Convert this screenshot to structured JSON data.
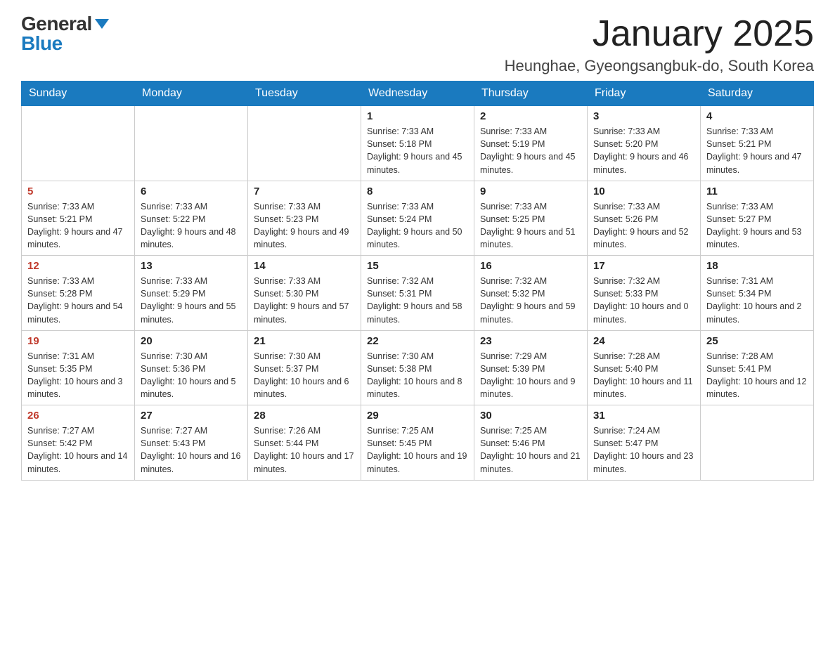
{
  "header": {
    "logo_general": "General",
    "logo_blue": "Blue",
    "title": "January 2025",
    "subtitle": "Heunghae, Gyeongsangbuk-do, South Korea"
  },
  "days_of_week": [
    "Sunday",
    "Monday",
    "Tuesday",
    "Wednesday",
    "Thursday",
    "Friday",
    "Saturday"
  ],
  "weeks": [
    [
      {
        "day": "",
        "info": ""
      },
      {
        "day": "",
        "info": ""
      },
      {
        "day": "",
        "info": ""
      },
      {
        "day": "1",
        "info": "Sunrise: 7:33 AM\nSunset: 5:18 PM\nDaylight: 9 hours and 45 minutes."
      },
      {
        "day": "2",
        "info": "Sunrise: 7:33 AM\nSunset: 5:19 PM\nDaylight: 9 hours and 45 minutes."
      },
      {
        "day": "3",
        "info": "Sunrise: 7:33 AM\nSunset: 5:20 PM\nDaylight: 9 hours and 46 minutes."
      },
      {
        "day": "4",
        "info": "Sunrise: 7:33 AM\nSunset: 5:21 PM\nDaylight: 9 hours and 47 minutes."
      }
    ],
    [
      {
        "day": "5",
        "info": "Sunrise: 7:33 AM\nSunset: 5:21 PM\nDaylight: 9 hours and 47 minutes."
      },
      {
        "day": "6",
        "info": "Sunrise: 7:33 AM\nSunset: 5:22 PM\nDaylight: 9 hours and 48 minutes."
      },
      {
        "day": "7",
        "info": "Sunrise: 7:33 AM\nSunset: 5:23 PM\nDaylight: 9 hours and 49 minutes."
      },
      {
        "day": "8",
        "info": "Sunrise: 7:33 AM\nSunset: 5:24 PM\nDaylight: 9 hours and 50 minutes."
      },
      {
        "day": "9",
        "info": "Sunrise: 7:33 AM\nSunset: 5:25 PM\nDaylight: 9 hours and 51 minutes."
      },
      {
        "day": "10",
        "info": "Sunrise: 7:33 AM\nSunset: 5:26 PM\nDaylight: 9 hours and 52 minutes."
      },
      {
        "day": "11",
        "info": "Sunrise: 7:33 AM\nSunset: 5:27 PM\nDaylight: 9 hours and 53 minutes."
      }
    ],
    [
      {
        "day": "12",
        "info": "Sunrise: 7:33 AM\nSunset: 5:28 PM\nDaylight: 9 hours and 54 minutes."
      },
      {
        "day": "13",
        "info": "Sunrise: 7:33 AM\nSunset: 5:29 PM\nDaylight: 9 hours and 55 minutes."
      },
      {
        "day": "14",
        "info": "Sunrise: 7:33 AM\nSunset: 5:30 PM\nDaylight: 9 hours and 57 minutes."
      },
      {
        "day": "15",
        "info": "Sunrise: 7:32 AM\nSunset: 5:31 PM\nDaylight: 9 hours and 58 minutes."
      },
      {
        "day": "16",
        "info": "Sunrise: 7:32 AM\nSunset: 5:32 PM\nDaylight: 9 hours and 59 minutes."
      },
      {
        "day": "17",
        "info": "Sunrise: 7:32 AM\nSunset: 5:33 PM\nDaylight: 10 hours and 0 minutes."
      },
      {
        "day": "18",
        "info": "Sunrise: 7:31 AM\nSunset: 5:34 PM\nDaylight: 10 hours and 2 minutes."
      }
    ],
    [
      {
        "day": "19",
        "info": "Sunrise: 7:31 AM\nSunset: 5:35 PM\nDaylight: 10 hours and 3 minutes."
      },
      {
        "day": "20",
        "info": "Sunrise: 7:30 AM\nSunset: 5:36 PM\nDaylight: 10 hours and 5 minutes."
      },
      {
        "day": "21",
        "info": "Sunrise: 7:30 AM\nSunset: 5:37 PM\nDaylight: 10 hours and 6 minutes."
      },
      {
        "day": "22",
        "info": "Sunrise: 7:30 AM\nSunset: 5:38 PM\nDaylight: 10 hours and 8 minutes."
      },
      {
        "day": "23",
        "info": "Sunrise: 7:29 AM\nSunset: 5:39 PM\nDaylight: 10 hours and 9 minutes."
      },
      {
        "day": "24",
        "info": "Sunrise: 7:28 AM\nSunset: 5:40 PM\nDaylight: 10 hours and 11 minutes."
      },
      {
        "day": "25",
        "info": "Sunrise: 7:28 AM\nSunset: 5:41 PM\nDaylight: 10 hours and 12 minutes."
      }
    ],
    [
      {
        "day": "26",
        "info": "Sunrise: 7:27 AM\nSunset: 5:42 PM\nDaylight: 10 hours and 14 minutes."
      },
      {
        "day": "27",
        "info": "Sunrise: 7:27 AM\nSunset: 5:43 PM\nDaylight: 10 hours and 16 minutes."
      },
      {
        "day": "28",
        "info": "Sunrise: 7:26 AM\nSunset: 5:44 PM\nDaylight: 10 hours and 17 minutes."
      },
      {
        "day": "29",
        "info": "Sunrise: 7:25 AM\nSunset: 5:45 PM\nDaylight: 10 hours and 19 minutes."
      },
      {
        "day": "30",
        "info": "Sunrise: 7:25 AM\nSunset: 5:46 PM\nDaylight: 10 hours and 21 minutes."
      },
      {
        "day": "31",
        "info": "Sunrise: 7:24 AM\nSunset: 5:47 PM\nDaylight: 10 hours and 23 minutes."
      },
      {
        "day": "",
        "info": ""
      }
    ]
  ]
}
